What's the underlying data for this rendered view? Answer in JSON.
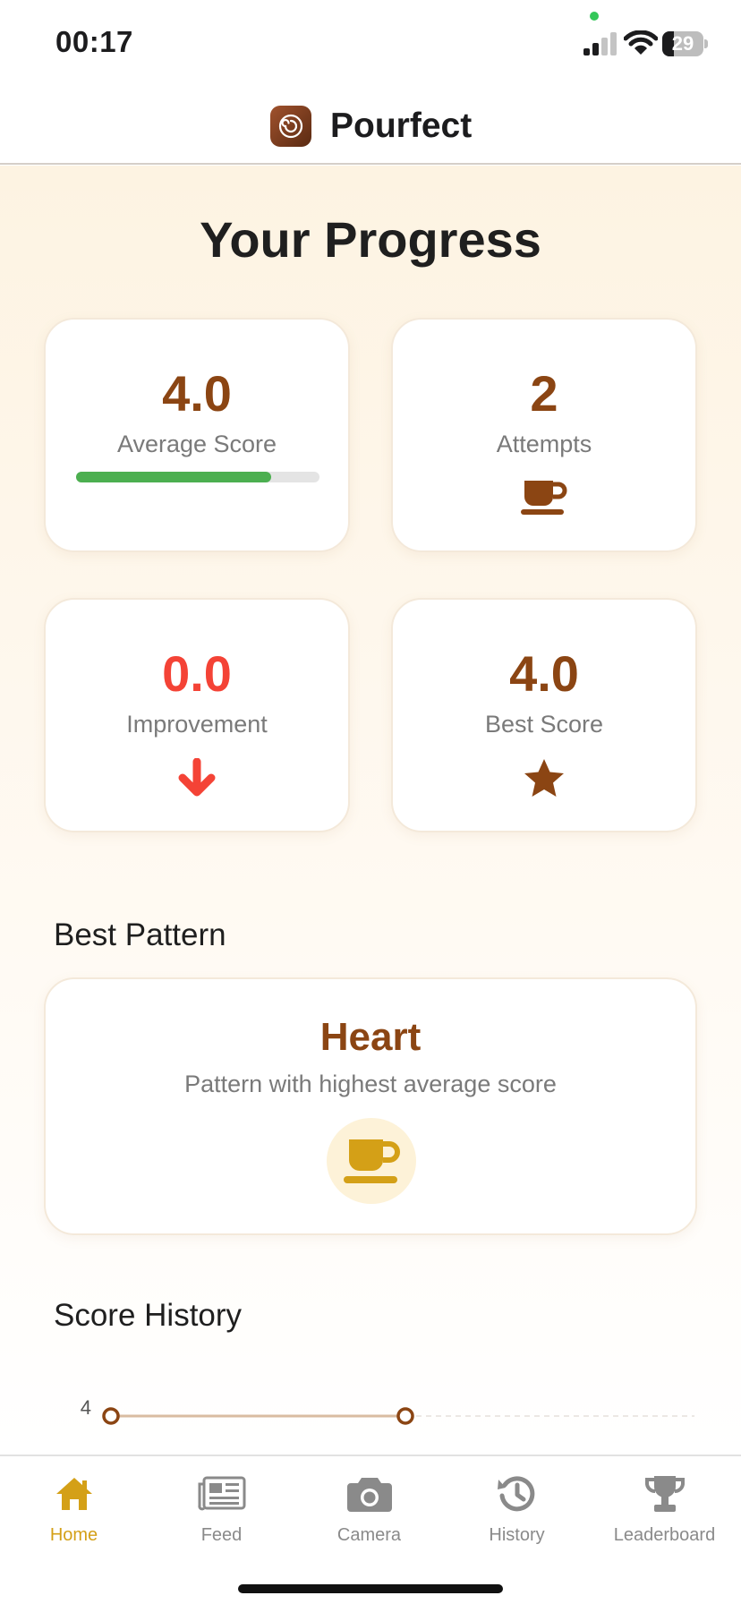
{
  "status_bar": {
    "time": "00:17",
    "battery_level": "29"
  },
  "header": {
    "app_name": "Pourfect",
    "logo_icon": "latte-art-swirl-icon"
  },
  "page": {
    "title": "Your Progress"
  },
  "stats": {
    "average": {
      "value": "4.0",
      "label": "Average Score",
      "progress": 0.8
    },
    "attempts": {
      "value": "2",
      "label": "Attempts",
      "icon": "coffee-cup-icon"
    },
    "improvement": {
      "value": "0.0",
      "label": "Improvement",
      "icon": "arrow-down-icon"
    },
    "best": {
      "value": "4.0",
      "label": "Best Score",
      "icon": "star-icon"
    }
  },
  "best_pattern": {
    "section_title": "Best Pattern",
    "name": "Heart",
    "description": "Pattern with highest average score",
    "icon": "coffee-cup-icon"
  },
  "score_history": {
    "section_title": "Score History"
  },
  "chart_data": {
    "type": "line",
    "x": [
      1,
      2
    ],
    "y": [
      4,
      4
    ],
    "ytick_labels": [
      "4"
    ]
  },
  "tabs": [
    {
      "label": "Home",
      "icon": "home-icon",
      "active": true
    },
    {
      "label": "Feed",
      "icon": "newspaper-icon",
      "active": false
    },
    {
      "label": "Camera",
      "icon": "camera-icon",
      "active": false
    },
    {
      "label": "History",
      "icon": "history-icon",
      "active": false
    },
    {
      "label": "Leaderboard",
      "icon": "trophy-icon",
      "active": false
    }
  ],
  "colors": {
    "brand_brown": "#8b4513",
    "accent_gold": "#d4a017",
    "negative_red": "#f44336",
    "progress_green": "#4caf50"
  }
}
